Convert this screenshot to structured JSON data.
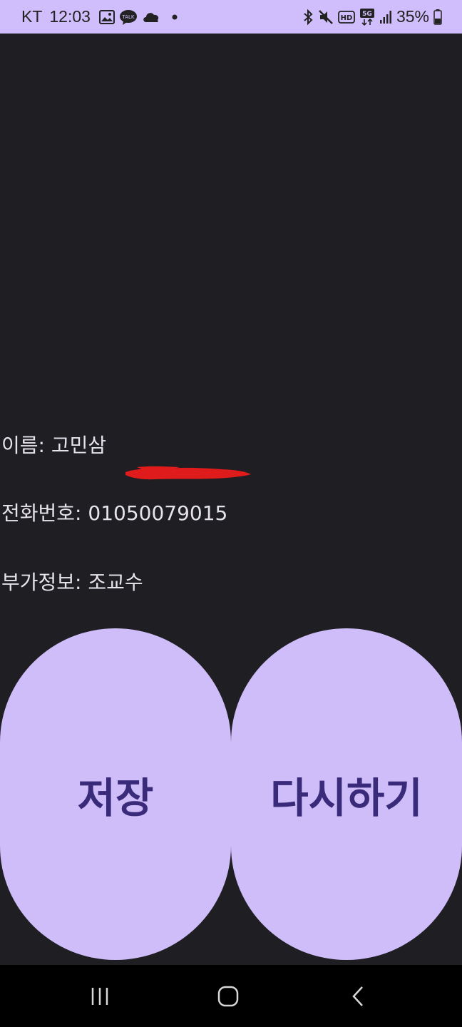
{
  "status_bar": {
    "carrier": "KT",
    "time": "12:03",
    "battery": "35%",
    "network": "5G",
    "hd_label": "HD",
    "icons_left": [
      "gallery-icon",
      "talk-icon",
      "cloud-icon",
      "dot-icon"
    ],
    "icons_right": [
      "bluetooth-icon",
      "mute-icon",
      "hd-icon",
      "5g-icon",
      "signal-icon",
      "battery-icon"
    ]
  },
  "info": {
    "name_line": "이름: 고민삼",
    "phone_line": "전화번호: 01050079015",
    "extra_line": "부가정보: 조교수"
  },
  "buttons": {
    "save_label": "저장",
    "retry_label": "다시하기"
  },
  "colors": {
    "accent": "#cfbdf9",
    "button_text": "#3a2a7a",
    "background": "#1f1e23",
    "redaction": "#e01b1b"
  },
  "nav_bar": {
    "items": [
      "recent-apps-icon",
      "home-icon",
      "back-icon"
    ]
  }
}
